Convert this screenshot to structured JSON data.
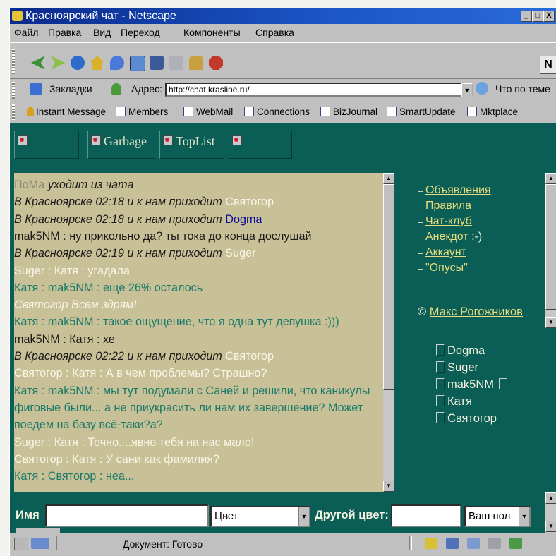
{
  "window": {
    "title": "Красноярский чат - Netscape",
    "controls": [
      "_",
      "□",
      "X"
    ]
  },
  "menu": [
    {
      "label": "Файл",
      "accel": "Ф",
      "rest": "айл"
    },
    {
      "label": "Правка",
      "accel": "П",
      "rest": "равка"
    },
    {
      "label": "Вид",
      "accel": "В",
      "rest": "ид"
    },
    {
      "label": "Переход",
      "accel": "е",
      "pre": "П",
      "rest": "реход"
    },
    {
      "label": "Компоненты",
      "accel": "К",
      "rest": "омпоненты"
    },
    {
      "label": "Справка",
      "accel": "С",
      "rest": "правка"
    }
  ],
  "toolbar": {
    "icons": [
      "back-icon",
      "forward-icon",
      "reload-icon",
      "home-icon",
      "search-icon",
      "my-netscape-icon",
      "guide-icon",
      "print-icon",
      "security-icon",
      "stop-icon"
    ],
    "logo": "N"
  },
  "location": {
    "bookmarks_label": "Закладки",
    "address_label": "Адрес:",
    "address_value": "http://chat.krasline.ru/",
    "whats_related": "Что по теме"
  },
  "links": [
    "Instant Message",
    "Members",
    "WebMail",
    "Connections",
    "BizJournal",
    "SmartUpdate",
    "Mktplace"
  ],
  "frame_buttons": [
    {
      "label": ""
    },
    {
      "label": "Garbage"
    },
    {
      "label": "TopList"
    },
    {
      "label": ""
    }
  ],
  "chat": {
    "lines": [
      [
        {
          "t": "ПоМа ",
          "c": "gray"
        },
        {
          "t": "уходит из чата",
          "c": "dark",
          "i": true
        }
      ],
      [
        {
          "t": "В Красноярске 02:18 и к нам приходит ",
          "c": "dark",
          "i": true
        },
        {
          "t": "Святогор",
          "c": "white"
        }
      ],
      [
        {
          "t": "В Красноярске 02:18 и к нам приходит ",
          "c": "dark",
          "i": true
        },
        {
          "t": "Dogma",
          "c": "blue"
        }
      ],
      [
        {
          "t": "mak5NM : ну прикольно да? ты тока до конца дослушай",
          "c": "dark"
        }
      ],
      [
        {
          "t": "В Красноярске 02:19 и к нам приходит ",
          "c": "dark",
          "i": true
        },
        {
          "t": "Suger",
          "c": "white"
        }
      ],
      [
        {
          "t": "Suger : Катя : угадала",
          "c": "white"
        }
      ],
      [
        {
          "t": "Катя : mak5NM : ещё 26% осталось",
          "c": "teal"
        }
      ],
      [
        {
          "t": "Святогор Всем здрям!",
          "c": "white",
          "i": true
        }
      ],
      [
        {
          "t": "Катя : mak5NM : такое ощущение, что я одна тут девушка :)))",
          "c": "teal"
        }
      ],
      [
        {
          "t": "mak5NM : Катя : хе",
          "c": "dark"
        }
      ],
      [
        {
          "t": "В Красноярске 02:22 и к нам приходит ",
          "c": "dark",
          "i": true
        },
        {
          "t": "Святогор",
          "c": "white"
        }
      ],
      [
        {
          "t": "Святогор : Катя : А в чем проблемы? Страшно?",
          "c": "white"
        }
      ],
      [
        {
          "t": "Катя : mak5NM : мы тут подумали с Саней и решили, что каникулы",
          "c": "teal"
        }
      ],
      [
        {
          "t": "фиговые были... а не приукрасить ли нам их завершение? Может",
          "c": "teal"
        }
      ],
      [
        {
          "t": "поедем на базу всё-таки?а?",
          "c": "teal"
        }
      ],
      [
        {
          "t": "Suger : Катя : Точно....явно тебя на нас мало!",
          "c": "white"
        }
      ],
      [
        {
          "t": "Святогор : Катя : У сани как фамилия?",
          "c": "white"
        }
      ],
      [
        {
          "t": "Катя : Святогор : неа...",
          "c": "teal"
        }
      ]
    ]
  },
  "nav": {
    "items": [
      {
        "label": "Объявления",
        "suffix": ""
      },
      {
        "label": "Правила",
        "suffix": ""
      },
      {
        "label": "Чат-клуб",
        "suffix": ""
      },
      {
        "label": "Анекдот",
        "suffix": " ;-)"
      },
      {
        "label": "Аккаунт",
        "suffix": ""
      },
      {
        "label": "\"Опусы\"",
        "suffix": ""
      }
    ],
    "copyright_symbol": "©",
    "copyright_name": "Макс Рогожников"
  },
  "users": [
    "Dogma",
    "Suger",
    "mak5NM",
    "Катя",
    "Святогор"
  ],
  "form": {
    "name_label": "Имя",
    "name_value": "",
    "color_select": "Цвет",
    "other_color_label": "Другой цвет:",
    "other_color_value": "",
    "gender_select": "Ваш пол"
  },
  "status": {
    "text": "Документ: Готово"
  },
  "colors": {
    "chat_bg": "#c8c096",
    "page_bg": "#0b5e55",
    "link": "#e6dd7e",
    "title_bar": "#0a2a8c"
  }
}
